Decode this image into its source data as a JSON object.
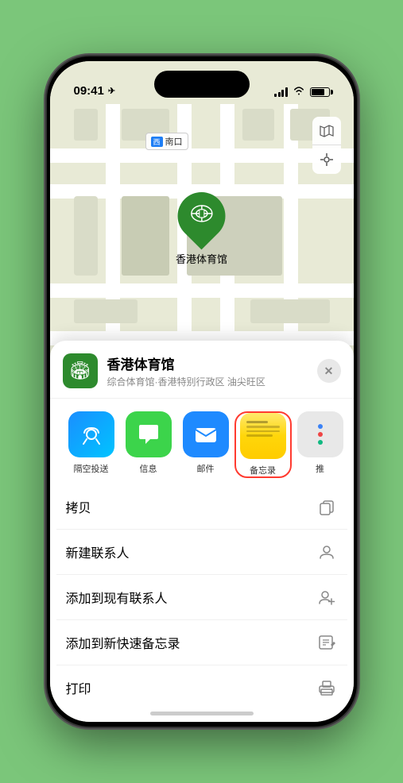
{
  "status_bar": {
    "time": "09:41",
    "location_arrow": "▶"
  },
  "map": {
    "label": "南口",
    "label_prefix": "西"
  },
  "pin": {
    "name": "香港体育馆",
    "emoji": "🏟"
  },
  "sheet": {
    "venue_name": "香港体育馆",
    "venue_sub": "综合体育馆·香港特别行政区 油尖旺区",
    "venue_emoji": "🏟"
  },
  "share_items": [
    {
      "label": "隔空投送",
      "type": "airdrop"
    },
    {
      "label": "信息",
      "type": "messages"
    },
    {
      "label": "邮件",
      "type": "mail"
    },
    {
      "label": "备忘录",
      "type": "notes",
      "selected": true
    },
    {
      "label": "推",
      "type": "more"
    }
  ],
  "actions": [
    {
      "label": "拷贝",
      "icon": "copy"
    },
    {
      "label": "新建联系人",
      "icon": "person"
    },
    {
      "label": "添加到现有联系人",
      "icon": "person-add"
    },
    {
      "label": "添加到新快速备忘录",
      "icon": "notes"
    },
    {
      "label": "打印",
      "icon": "print"
    }
  ],
  "close_label": "✕"
}
